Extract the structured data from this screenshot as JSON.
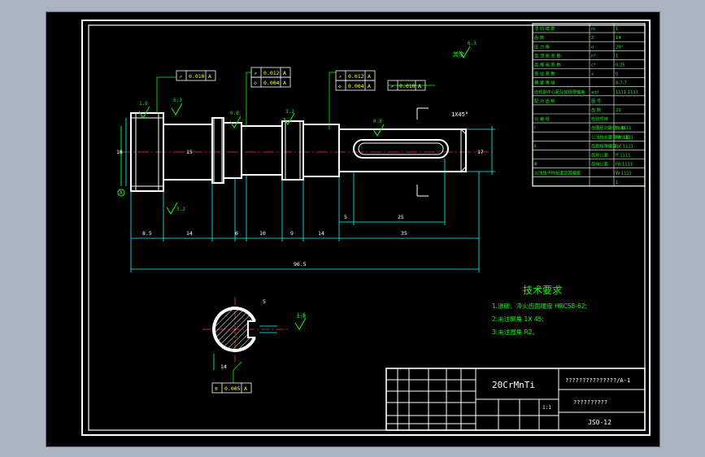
{
  "colors": {
    "paper": "#000000",
    "frame": "#ffffff",
    "geometry": "#ffffff",
    "dimension": "#00ffff",
    "annotation": "#00ff00",
    "centerline": "#ff3030",
    "hatch": "#ffffff",
    "tolerance": "#ffff00"
  },
  "drawing": {
    "dims": {
      "d1": "8.5",
      "d2": "14",
      "d3": "6",
      "d4": "10",
      "d5": "9",
      "d6": "14",
      "d7": "35",
      "d8": "5",
      "d9": "25",
      "total": "96.5",
      "dia_left": "18",
      "dia_mid": "15",
      "dia_right": "17",
      "chamfer": "1X45°"
    },
    "roughness": {
      "r1": "1.6",
      "r2": "6.3",
      "r3": "0.8",
      "r4": "3.2",
      "r5": "0.8",
      "r6": "3.2",
      "r7": "1.6",
      "r8": "6.3",
      "other": "其余"
    },
    "tolerance_frames": {
      "t1": {
        "symbol": "↗",
        "value": "0.010",
        "datum": "A"
      },
      "t2": {
        "symbol": "↗",
        "value": "0.012",
        "datum": "A"
      },
      "t3": {
        "symbol": "◇",
        "value": "0.004",
        "datum": "A"
      },
      "t4": {
        "symbol": "↗",
        "value": "0.012",
        "datum": "A"
      },
      "t5": {
        "symbol": "◇",
        "value": "0.004",
        "datum": "A"
      },
      "t6": {
        "symbol": "↗",
        "value": "0.010",
        "datum": "A"
      },
      "t7": {
        "symbol": "≡",
        "value": "0.005",
        "datum": "A"
      }
    },
    "section": {
      "dim_a": "5",
      "dim_b": "14",
      "roughness": "1.6"
    }
  },
  "tech_requirements": {
    "title": "技术要求",
    "items": [
      "1.渗碳、淬火齿面硬度 HRC58-62;",
      "2.未注倒角 1X 45;",
      "3.未注圆角 R2。"
    ]
  },
  "param_table": [
    [
      "法 向 模 数",
      "m",
      "1"
    ],
    [
      "齿 数",
      "Z",
      "14"
    ],
    [
      "压 力 角",
      "α",
      "20°"
    ],
    [
      "齿 顶 高 系 数",
      "h*",
      "1"
    ],
    [
      "齿 根 高 系 数",
      "c*",
      "0.25"
    ],
    [
      "变 位 系 数",
      "x",
      "0"
    ],
    [
      "精 度 等 级",
      "",
      "8-7-7"
    ],
    [
      "齿轮副中心距及其极限偏差",
      "a±f",
      "1111 1111"
    ],
    [
      "配 对 齿 轮",
      "图 号",
      ""
    ],
    [
      "",
      "齿 数",
      "23"
    ],
    [
      "公 差 组",
      "检验项目",
      ""
    ],
    [
      "Ⅰ",
      "齿圈径向跳动公差",
      "Fr  1111"
    ],
    [
      "",
      "公法线长度变动公差",
      "Fw  1111"
    ],
    [
      "Ⅱ",
      "齿距极限偏差",
      "fpt  1111"
    ],
    [
      "",
      "齿形公差",
      "ff  1111"
    ],
    [
      "Ⅲ",
      "齿向公差",
      "Fβ  1111"
    ],
    [
      "公法线平均长度及其偏差",
      "",
      "W 1111"
    ],
    [
      "",
      "",
      "1"
    ]
  ],
  "title_block": {
    "material": "20CrMnTi",
    "drawing_name": "???????????????/A-1",
    "company": "??????????",
    "drawing_no": "JS0-12",
    "scale": "1:1"
  }
}
